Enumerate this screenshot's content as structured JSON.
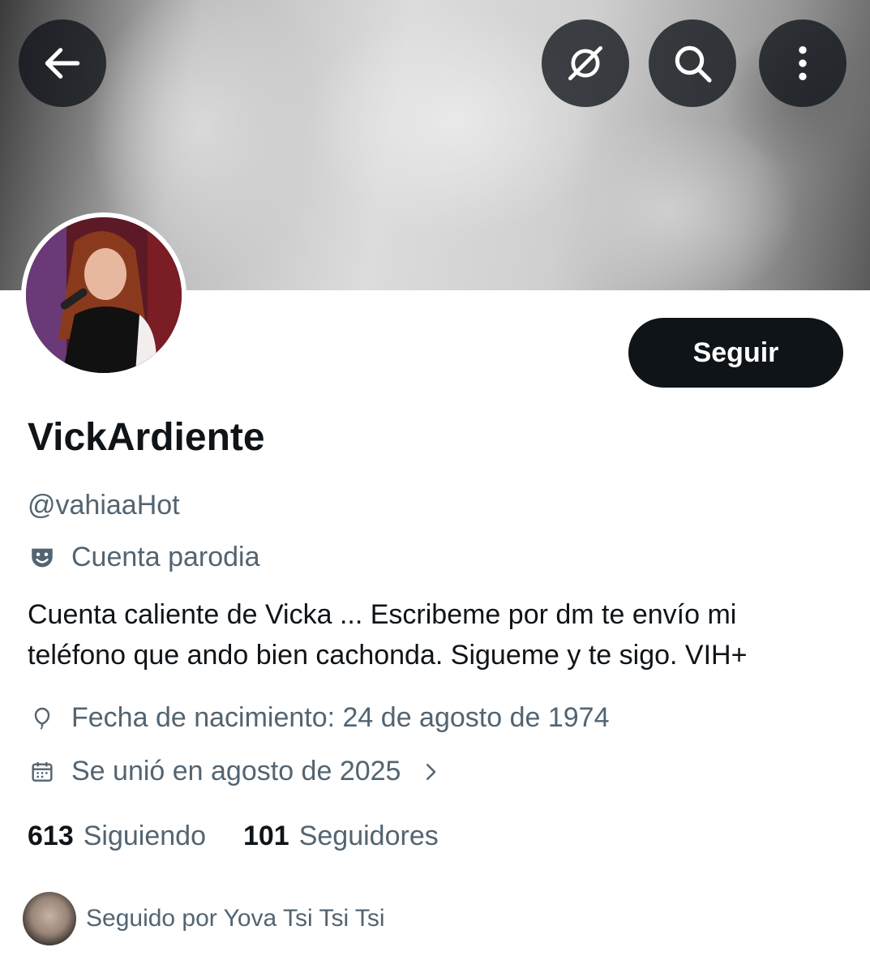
{
  "header": {
    "back_icon": "arrow-left-icon",
    "grok_icon": "grok-icon",
    "search_icon": "search-icon",
    "more_icon": "more-vertical-icon"
  },
  "profile": {
    "display_name": "VickArdiente",
    "handle": "@vahiaaHot",
    "label": "Cuenta parodia",
    "label_icon": "parody-mask-icon",
    "bio_line1": "Cuenta caliente de Vicka ... Escribeme por dm te envío mi",
    "bio_line2": "teléfono que ando bien cachonda. Sigueme y te sigo. VIH+",
    "birthdate": "Fecha de nacimiento: 24 de agosto de 1974",
    "joined": "Se unió en agosto de 2025",
    "follow_button": "Seguir"
  },
  "stats": {
    "following_count": "613",
    "following_label": "Siguiendo",
    "followers_count": "101",
    "followers_label": "Seguidores"
  },
  "followed_by": {
    "text": "Seguido por Yova Tsi Tsi Tsi"
  },
  "colors": {
    "primary_text": "#0f1419",
    "secondary_text": "#536471",
    "button_bg": "#0f1419",
    "button_text": "#ffffff"
  }
}
